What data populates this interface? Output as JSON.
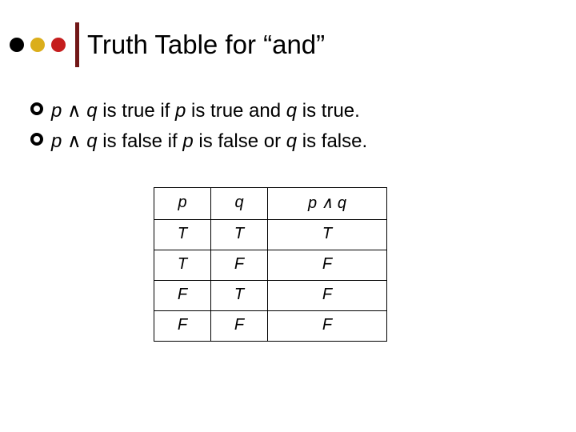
{
  "colors": {
    "dot1": "#000000",
    "dot2": "#dbae1b",
    "dot3": "#c51e1e",
    "divider": "#711717"
  },
  "title": "Truth Table for “and”",
  "bullets": {
    "b1": {
      "p": "p",
      "op": "∧",
      "q": "q",
      "rest": " is true if ",
      "p2": "p",
      "mid": " is true and ",
      "q2": "q",
      "end": " is true."
    },
    "b2": {
      "p": "p",
      "op": "∧",
      "q": "q",
      "rest": " is false if ",
      "p2": "p",
      "mid": " is false or ",
      "q2": "q",
      "end": " is false."
    }
  },
  "chart_data": {
    "type": "table",
    "title": "Truth Table for “and”",
    "columns": [
      "p",
      "q",
      "p ∧ q"
    ],
    "rows": [
      [
        "T",
        "T",
        "T"
      ],
      [
        "T",
        "F",
        "F"
      ],
      [
        "F",
        "T",
        "F"
      ],
      [
        "F",
        "F",
        "F"
      ]
    ]
  },
  "table": {
    "h1": "p",
    "h2": "q",
    "h3_p": "p",
    "h3_op": "∧",
    "h3_q": "q",
    "r0c0": "T",
    "r0c1": "T",
    "r0c2": "T",
    "r1c0": "T",
    "r1c1": "F",
    "r1c2": "F",
    "r2c0": "F",
    "r2c1": "T",
    "r2c2": "F",
    "r3c0": "F",
    "r3c1": "F",
    "r3c2": "F"
  }
}
